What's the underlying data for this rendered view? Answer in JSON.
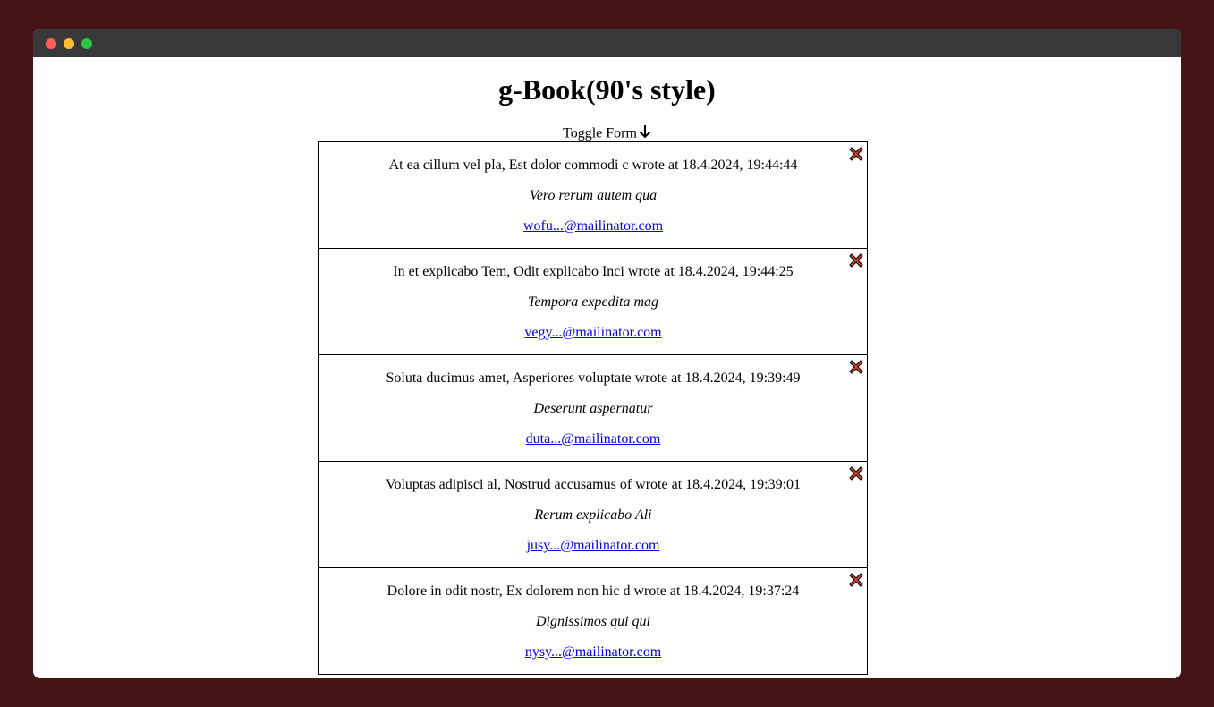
{
  "page": {
    "title": "g-Book(90's style)",
    "toggle_label": "Toggle Form"
  },
  "colors": {
    "backdrop": "#461416",
    "titlebar": "#38383a",
    "link": "#0000ee",
    "delete_fill": "#e0442a"
  },
  "entries": [
    {
      "header": "At ea cillum vel pla, Est dolor commodi c wrote at 18.4.2024, 19:44:44",
      "message": "Vero rerum autem qua",
      "email": "wofu...@mailinator.com"
    },
    {
      "header": "In et explicabo Tem, Odit explicabo Inci wrote at 18.4.2024, 19:44:25",
      "message": "Tempora expedita mag",
      "email": "vegy...@mailinator.com"
    },
    {
      "header": "Soluta ducimus amet, Asperiores voluptate wrote at 18.4.2024, 19:39:49",
      "message": "Deserunt aspernatur",
      "email": "duta...@mailinator.com"
    },
    {
      "header": "Voluptas adipisci al, Nostrud accusamus of wrote at 18.4.2024, 19:39:01",
      "message": "Rerum explicabo Ali",
      "email": "jusy...@mailinator.com"
    },
    {
      "header": "Dolore in odit nostr, Ex dolorem non hic d wrote at 18.4.2024, 19:37:24",
      "message": "Dignissimos qui qui",
      "email": "nysy...@mailinator.com"
    }
  ]
}
